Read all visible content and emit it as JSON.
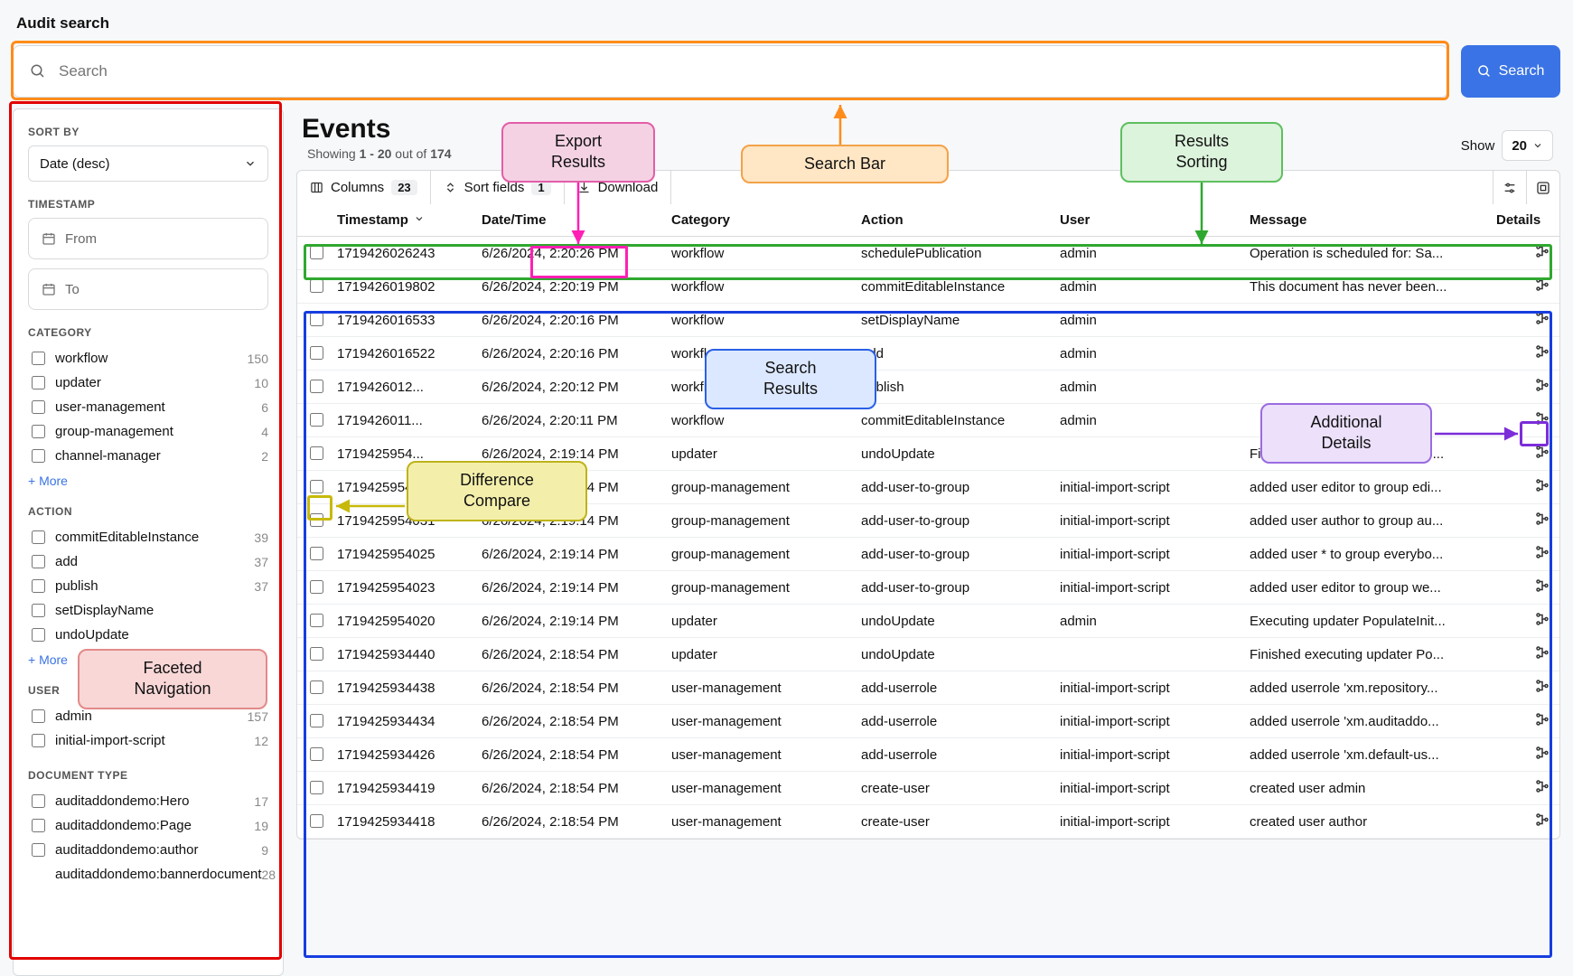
{
  "page": {
    "title": "Audit search"
  },
  "search": {
    "placeholder": "Search",
    "button": "Search"
  },
  "sidebar": {
    "sort_by_label": "SORT BY",
    "sort_value": "Date (desc)",
    "timestamp_label": "TIMESTAMP",
    "from_placeholder": "From",
    "to_placeholder": "To",
    "category_label": "CATEGORY",
    "category_items": [
      {
        "label": "workflow",
        "count": "150"
      },
      {
        "label": "updater",
        "count": "10"
      },
      {
        "label": "user-management",
        "count": "6"
      },
      {
        "label": "group-management",
        "count": "4"
      },
      {
        "label": "channel-manager",
        "count": "2"
      }
    ],
    "action_label": "ACTION",
    "action_items": [
      {
        "label": "commitEditableInstance",
        "count": "39"
      },
      {
        "label": "add",
        "count": "37"
      },
      {
        "label": "publish",
        "count": "37"
      },
      {
        "label": "setDisplayName",
        "count": ""
      },
      {
        "label": "undoUpdate",
        "count": ""
      }
    ],
    "user_label": "USER",
    "user_items": [
      {
        "label": "admin",
        "count": "157"
      },
      {
        "label": "initial-import-script",
        "count": "12"
      }
    ],
    "doctype_label": "DOCUMENT TYPE",
    "doctype_items": [
      {
        "label": "auditaddondemo:Hero",
        "count": "17"
      },
      {
        "label": "auditaddondemo:Page",
        "count": "19"
      },
      {
        "label": "auditaddondemo:author",
        "count": "9"
      },
      {
        "label": "auditaddondemo:bannerdocument",
        "count": "28"
      }
    ],
    "more": "+ More"
  },
  "events": {
    "title": "Events",
    "showing_prefix": "Showing ",
    "showing_range": "1 - 20",
    "showing_mid": " out of ",
    "showing_total": "174",
    "show_label": "Show",
    "show_value": "20"
  },
  "toolbar": {
    "columns_label": "Columns",
    "columns_count": "23",
    "sort_label": "Sort fields",
    "sort_count": "1",
    "download_label": "Download"
  },
  "columns": {
    "timestamp": "Timestamp",
    "datetime": "Date/Time",
    "category": "Category",
    "action": "Action",
    "user": "User",
    "message": "Message",
    "details": "Details"
  },
  "rows": [
    {
      "ts": "1719426026243",
      "dt": "6/26/2024, 2:20:26 PM",
      "cat": "workflow",
      "act": "schedulePublication",
      "user": "admin",
      "msg": "Operation is scheduled for: Sa..."
    },
    {
      "ts": "1719426019802",
      "dt": "6/26/2024, 2:20:19 PM",
      "cat": "workflow",
      "act": "commitEditableInstance",
      "user": "admin",
      "msg": "This document has never been..."
    },
    {
      "ts": "1719426016533",
      "dt": "6/26/2024, 2:20:16 PM",
      "cat": "workflow",
      "act": "setDisplayName",
      "user": "admin",
      "msg": ""
    },
    {
      "ts": "1719426016522",
      "dt": "6/26/2024, 2:20:16 PM",
      "cat": "workflow",
      "act": "add",
      "user": "admin",
      "msg": ""
    },
    {
      "ts": "1719426012...",
      "dt": "6/26/2024, 2:20:12 PM",
      "cat": "workflow",
      "act": "publish",
      "user": "admin",
      "msg": ""
    },
    {
      "ts": "1719426011...",
      "dt": "6/26/2024, 2:20:11 PM",
      "cat": "workflow",
      "act": "commitEditableInstance",
      "user": "admin",
      "msg": ""
    },
    {
      "ts": "1719425954...",
      "dt": "6/26/2024, 2:19:14 PM",
      "cat": "updater",
      "act": "undoUpdate",
      "user": "",
      "msg": "Finished executing updater Po..."
    },
    {
      "ts": "1719425954033",
      "dt": "6/26/2024, 2:19:14 PM",
      "cat": "group-management",
      "act": "add-user-to-group",
      "user": "initial-import-script",
      "msg": "added user editor to group edi..."
    },
    {
      "ts": "1719425954031",
      "dt": "6/26/2024, 2:19:14 PM",
      "cat": "group-management",
      "act": "add-user-to-group",
      "user": "initial-import-script",
      "msg": "added user author to group au..."
    },
    {
      "ts": "1719425954025",
      "dt": "6/26/2024, 2:19:14 PM",
      "cat": "group-management",
      "act": "add-user-to-group",
      "user": "initial-import-script",
      "msg": "added user * to group everybo..."
    },
    {
      "ts": "1719425954023",
      "dt": "6/26/2024, 2:19:14 PM",
      "cat": "group-management",
      "act": "add-user-to-group",
      "user": "initial-import-script",
      "msg": "added user editor to group we..."
    },
    {
      "ts": "1719425954020",
      "dt": "6/26/2024, 2:19:14 PM",
      "cat": "updater",
      "act": "undoUpdate",
      "user": "admin",
      "msg": "Executing updater PopulateInit..."
    },
    {
      "ts": "1719425934440",
      "dt": "6/26/2024, 2:18:54 PM",
      "cat": "updater",
      "act": "undoUpdate",
      "user": "",
      "msg": "Finished executing updater Po..."
    },
    {
      "ts": "1719425934438",
      "dt": "6/26/2024, 2:18:54 PM",
      "cat": "user-management",
      "act": "add-userrole",
      "user": "initial-import-script",
      "msg": "added userrole 'xm.repository..."
    },
    {
      "ts": "1719425934434",
      "dt": "6/26/2024, 2:18:54 PM",
      "cat": "user-management",
      "act": "add-userrole",
      "user": "initial-import-script",
      "msg": "added userrole 'xm.auditaddo..."
    },
    {
      "ts": "1719425934426",
      "dt": "6/26/2024, 2:18:54 PM",
      "cat": "user-management",
      "act": "add-userrole",
      "user": "initial-import-script",
      "msg": "added userrole 'xm.default-us..."
    },
    {
      "ts": "1719425934419",
      "dt": "6/26/2024, 2:18:54 PM",
      "cat": "user-management",
      "act": "create-user",
      "user": "initial-import-script",
      "msg": "created user admin"
    },
    {
      "ts": "1719425934418",
      "dt": "6/26/2024, 2:18:54 PM",
      "cat": "user-management",
      "act": "create-user",
      "user": "initial-import-script",
      "msg": "created user author"
    }
  ],
  "annotations": {
    "search_bar": "Search Bar",
    "export": "Export\nResults",
    "sorting": "Results\nSorting",
    "results": "Search\nResults",
    "details": "Additional\nDetails",
    "diff": "Difference\nCompare",
    "facets": "Faceted\nNavigation"
  }
}
